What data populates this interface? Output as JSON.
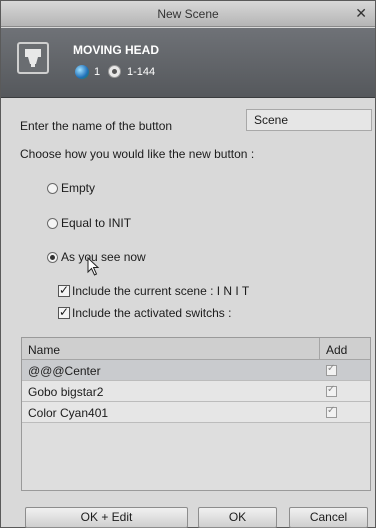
{
  "window": {
    "title": "New Scene"
  },
  "fixture": {
    "name": "MOVING HEAD",
    "count": "1",
    "dmx_range": "1-144"
  },
  "form": {
    "name_label": "Enter the name of the button",
    "name_value": "Scene",
    "choose_label": "Choose how you would like the new button :",
    "options": [
      {
        "label": "Empty",
        "selected": false
      },
      {
        "label": "Equal to INIT",
        "selected": false
      },
      {
        "label": "As you see now",
        "selected": true
      }
    ],
    "include_current": "Include the current scene : I N I T",
    "include_activated": "Include the activated switchs :"
  },
  "table": {
    "columns": [
      "Name",
      "Add"
    ],
    "rows": [
      {
        "name": "@@@Center",
        "add": true
      },
      {
        "name": "Gobo bigstar2",
        "add": true
      },
      {
        "name": "Color Cyan401",
        "add": true
      }
    ]
  },
  "buttons": {
    "ok_edit": "OK + Edit",
    "ok": "OK",
    "cancel": "Cancel"
  },
  "icons": [
    "fixture-icon",
    "globe-icon",
    "dmx-icon",
    "close-icon",
    "mouse-cursor-icon"
  ]
}
